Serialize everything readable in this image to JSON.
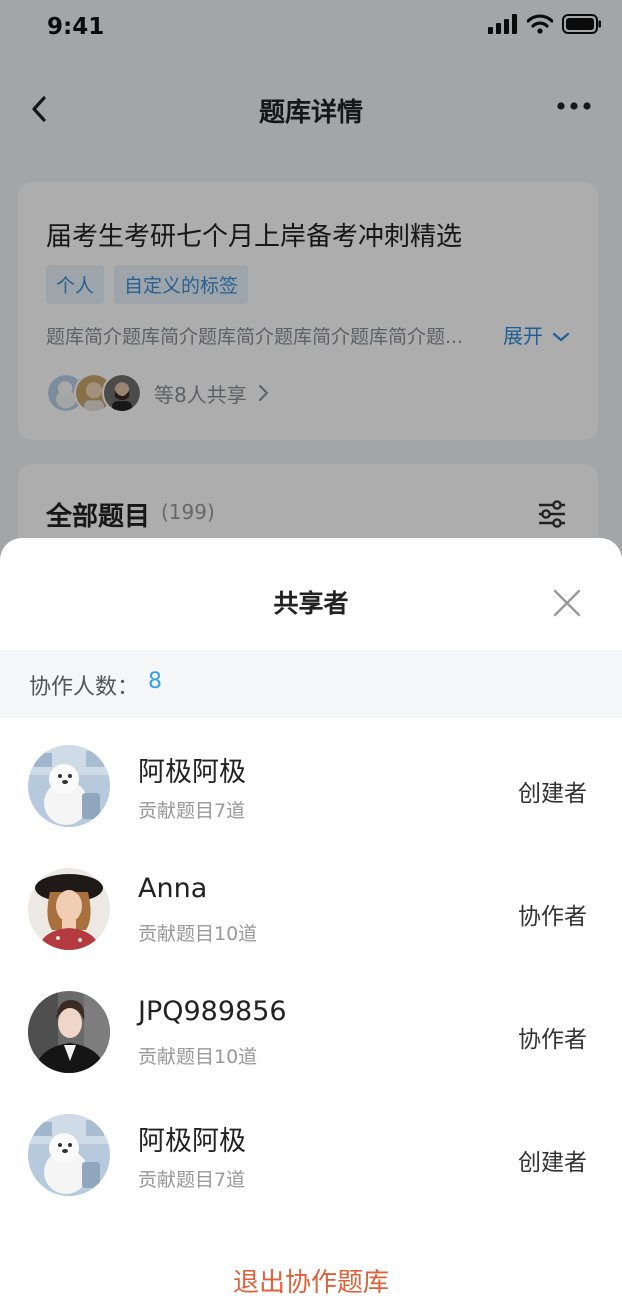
{
  "status_bar": {
    "time": "9:41"
  },
  "nav": {
    "title": "题库详情"
  },
  "bank_card": {
    "title": "届考生考研七个月上岸备考冲刺精选",
    "tags": [
      "个人",
      "自定义的标签"
    ],
    "description": "题库简介题库简介题库简介题库简介题库简介题...",
    "expand_label": "展开",
    "share_text": "等8人共享"
  },
  "questions_card": {
    "title": "全部题目",
    "count": "(199)"
  },
  "sheet": {
    "title": "共享者",
    "collaborator_label": "协作人数：",
    "collaborator_count": "8",
    "members": [
      {
        "name": "阿极阿极",
        "contribution": "贡献题目7道",
        "role": "创建者"
      },
      {
        "name": "Anna",
        "contribution": "贡献题目10道",
        "role": "协作者"
      },
      {
        "name": "JPQ989856",
        "contribution": "贡献题目10道",
        "role": "协作者"
      },
      {
        "name": "阿极阿极",
        "contribution": "贡献题目7道",
        "role": "创建者"
      }
    ],
    "exit_label": "退出协作题库"
  },
  "colors": {
    "accent_blue": "#2fa3e6",
    "link_blue": "#2f8ce0",
    "exit_orange": "#e0623a",
    "tag_bg": "#e9f3fb"
  }
}
